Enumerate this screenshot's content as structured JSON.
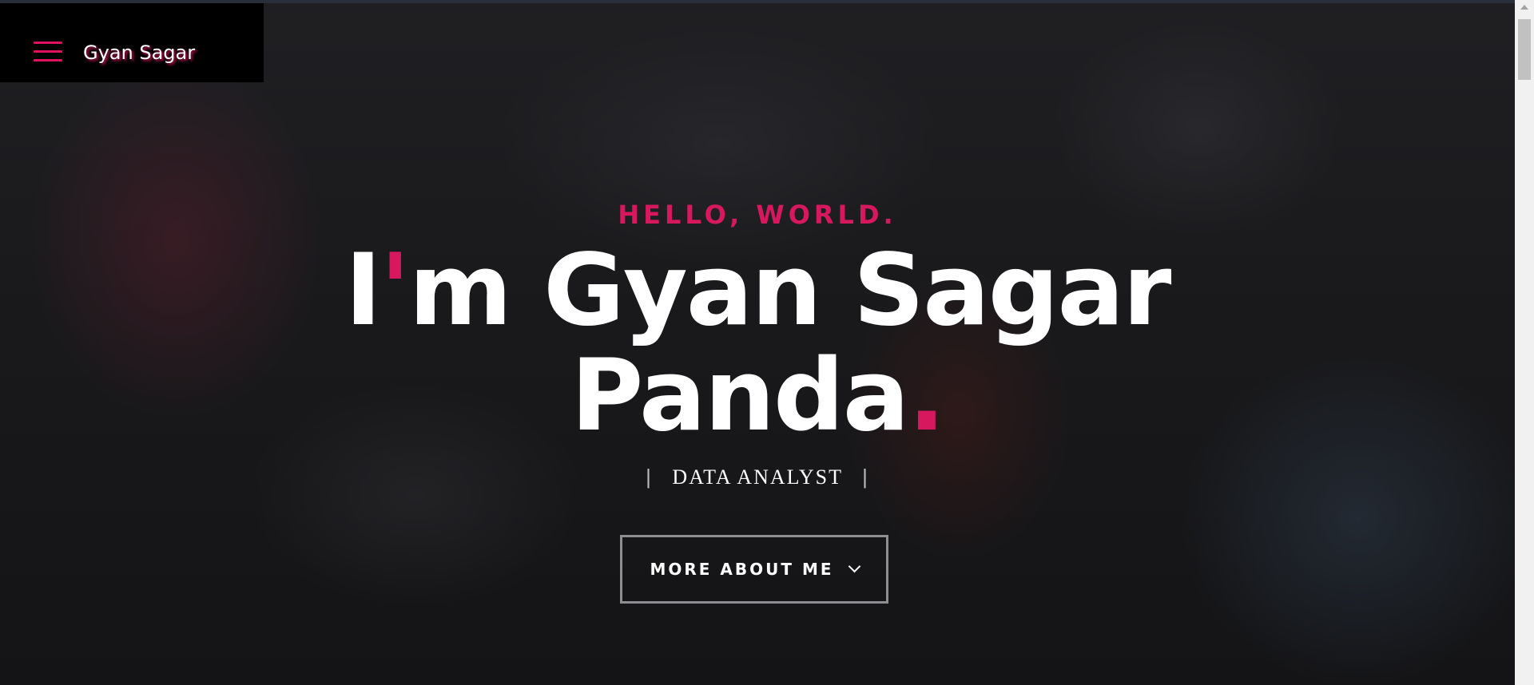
{
  "nav": {
    "site_title": "Gyan Sagar",
    "menu_icon": "hamburger-menu-icon",
    "accent_color": "#e0115f"
  },
  "hero": {
    "kicker": "HELLO, WORLD.",
    "headline_line1_prefix": "I",
    "headline_line1_apostrophe": "'",
    "headline_line1_rest": "m Gyan Sagar",
    "headline_line2_text": "Panda",
    "headline_line2_dot": ".",
    "role_divider_left": "|",
    "role": "DATA ANALYST",
    "role_divider_right": "|",
    "cta_label": "MORE ABOUT ME",
    "cta_icon": "chevron-down-icon"
  }
}
